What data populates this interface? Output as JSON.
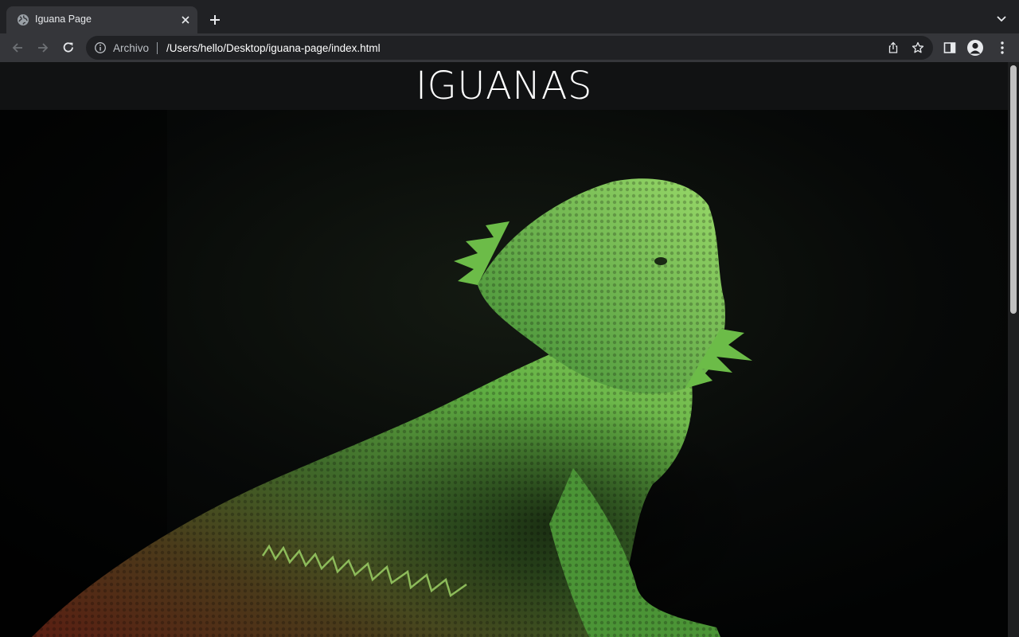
{
  "browser": {
    "tab": {
      "title": "Iguana Page",
      "favicon": "globe-icon"
    },
    "new_tab_icon": "plus-icon",
    "tab_search_icon": "chevron-down-icon",
    "address_bar": {
      "scheme_label": "Archivo",
      "url": "/Users/hello/Desktop/iguana-page/index.html"
    },
    "icons": [
      "back-arrow-icon",
      "forward-arrow-icon",
      "reload-icon",
      "info-icon",
      "share-icon",
      "star-icon",
      "side-panel-icon",
      "profile-icon",
      "more-menu-icon"
    ]
  },
  "page": {
    "title": "IGUANAS",
    "hero_image": "green bearded dragon lizard photo",
    "colors": {
      "header_bg": "#111213",
      "lizard_green": "#5fb040",
      "background": "#060707"
    }
  }
}
